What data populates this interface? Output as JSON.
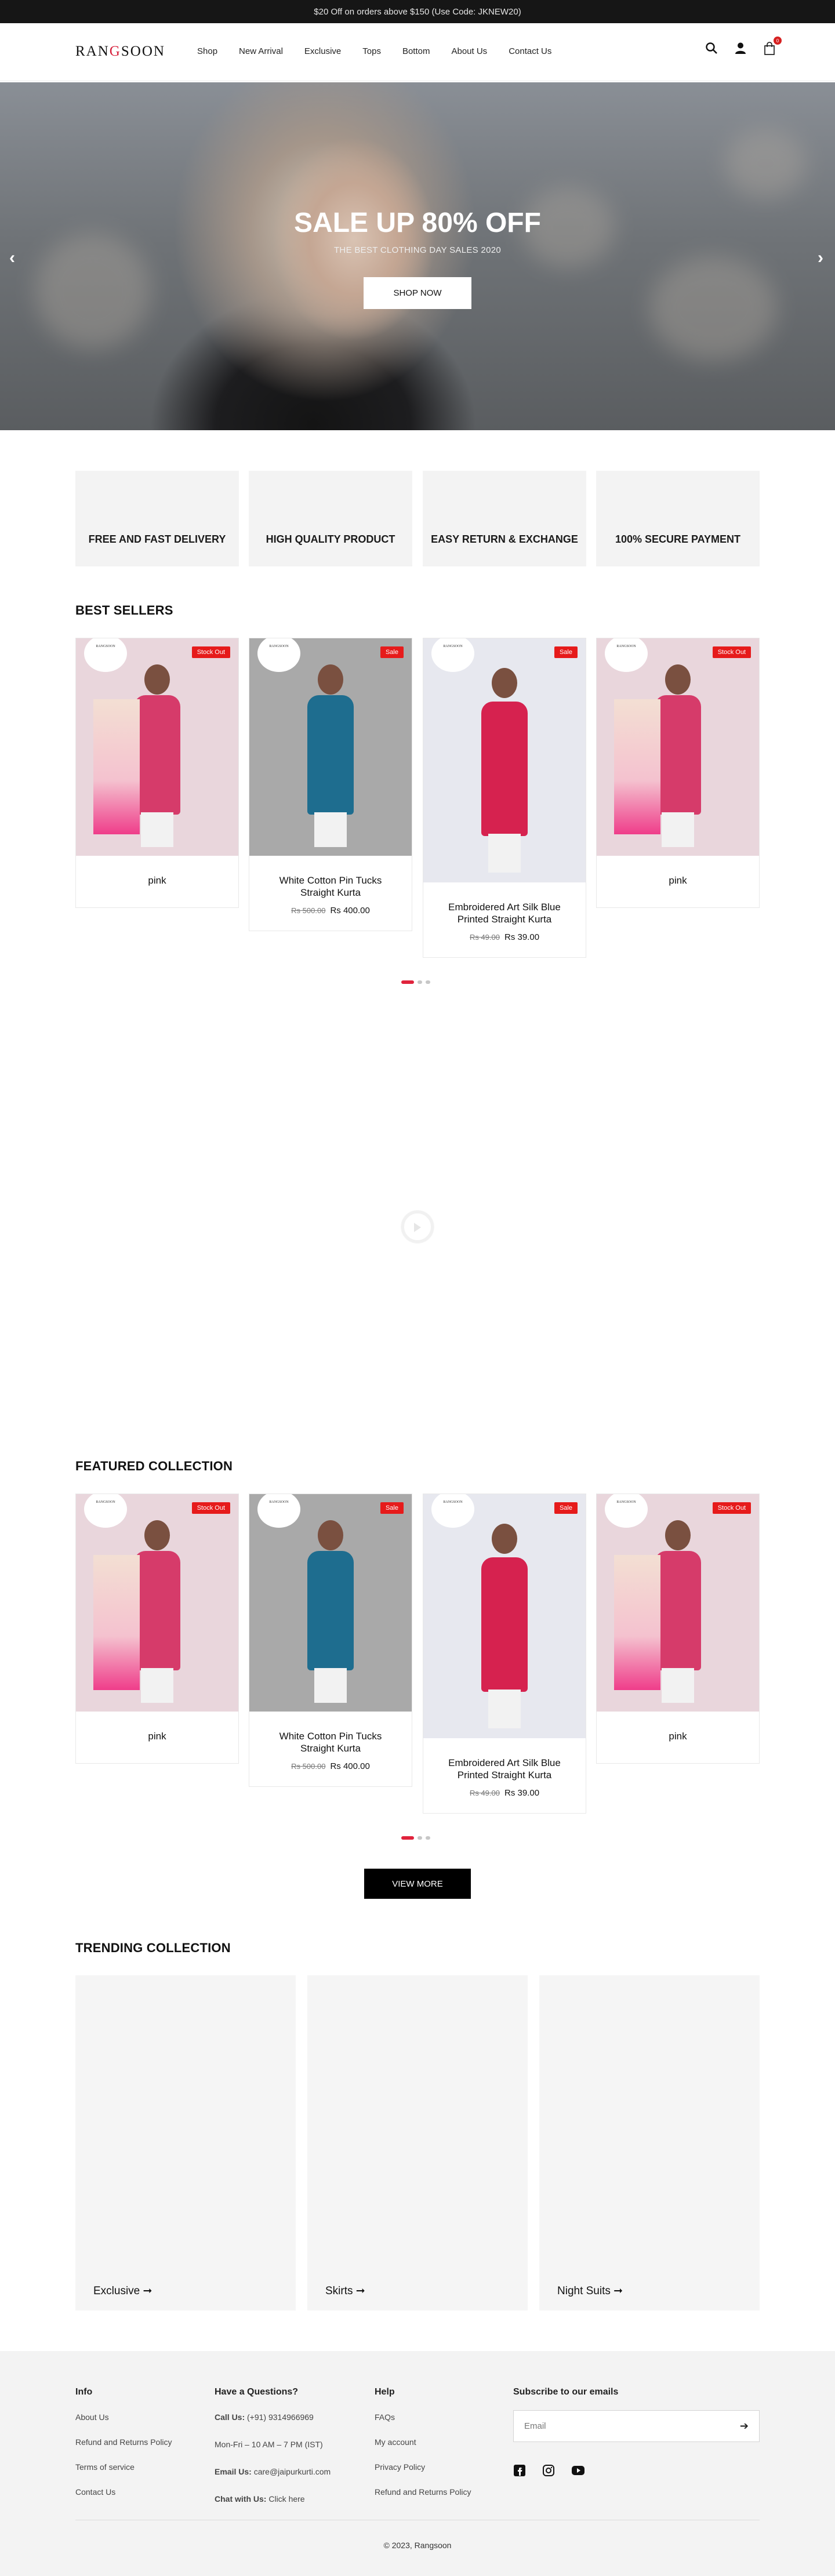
{
  "announcement": "$20 Off on orders above $150 (Use Code: JKNEW20)",
  "brand": {
    "prefix": "RAN",
    "accent": "G",
    "suffix": "SOON",
    "accent_color": "#d61f3a"
  },
  "nav": [
    "Shop",
    "New Arrival",
    "Exclusive",
    "Tops",
    "Bottom",
    "About Us",
    "Contact Us"
  ],
  "header_icons": {
    "search": "search-icon",
    "account": "user-icon",
    "cart": "bag-icon",
    "cart_count": "0"
  },
  "hero": {
    "title": "SALE UP 80% OFF",
    "subtitle": "THE BEST CLOTHING DAY SALES 2020",
    "cta": "SHOP NOW",
    "prev": "‹",
    "next": "›"
  },
  "features": [
    "FREE AND FAST DELIVERY",
    "HIGH QUALITY PRODUCT",
    "EASY RETURN & EXCHANGE",
    "100% SECURE PAYMENT"
  ],
  "best_sellers": {
    "title": "BEST SELLERS",
    "products": [
      {
        "name": "pink",
        "tag": "Stock Out",
        "old_price": "",
        "price": ""
      },
      {
        "name": "White Cotton Pin Tucks Straight Kurta",
        "tag": "Sale",
        "old_price": "Rs 500.00",
        "price": "Rs 400.00"
      },
      {
        "name": "Embroidered Art Silk Blue Printed Straight Kurta",
        "tag": "Sale",
        "old_price": "Rs 49.00",
        "price": "Rs 39.00"
      },
      {
        "name": "pink",
        "tag": "Stock Out",
        "old_price": "",
        "price": ""
      }
    ]
  },
  "featured": {
    "title": "FEATURED COLLECTION",
    "products": [
      {
        "name": "pink",
        "tag": "Stock Out",
        "old_price": "",
        "price": ""
      },
      {
        "name": "White Cotton Pin Tucks Straight Kurta",
        "tag": "Sale",
        "old_price": "Rs 500.00",
        "price": "Rs 400.00"
      },
      {
        "name": "Embroidered Art Silk Blue Printed Straight Kurta",
        "tag": "Sale",
        "old_price": "Rs 49.00",
        "price": "Rs 39.00"
      },
      {
        "name": "pink",
        "tag": "Stock Out",
        "old_price": "",
        "price": ""
      }
    ],
    "view_more": "VIEW MORE"
  },
  "trending": {
    "title": "TRENDING COLLECTION",
    "items": [
      "Exclusive",
      "Skirts",
      "Night Suits"
    ]
  },
  "footer": {
    "info": {
      "heading": "Info",
      "links": [
        "About Us",
        "Refund and Returns Policy",
        "Terms of service",
        "Contact Us"
      ]
    },
    "questions": {
      "heading": "Have a Questions?",
      "call_label": "Call Us:",
      "call_value": "(+91) 9314966969",
      "hours": "Mon-Fri – 10 AM – 7 PM (IST)",
      "email_label": "Email Us:",
      "email_value": "care@jaipurkurti.com",
      "chat_label": "Chat with Us:",
      "chat_value": "Click here"
    },
    "help": {
      "heading": "Help",
      "links": [
        "FAQs",
        "My account",
        "Privacy Policy",
        "Refund and Returns Policy"
      ]
    },
    "subscribe": {
      "heading": "Subscribe to our emails",
      "placeholder": "Email"
    },
    "social": [
      "facebook-icon",
      "instagram-icon",
      "youtube-icon"
    ],
    "copyright": "© 2023, Rangsoon"
  }
}
